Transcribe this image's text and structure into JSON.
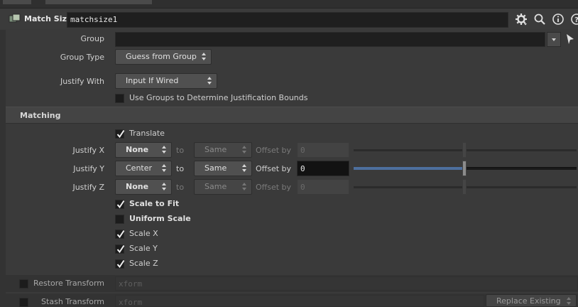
{
  "header": {
    "node_type_label": "Match Size",
    "node_name": "matchsize1",
    "icons": [
      "gear-icon",
      "search-icon",
      "info-icon",
      "help-icon"
    ]
  },
  "params": {
    "group": {
      "label": "Group",
      "value": ""
    },
    "group_type": {
      "label": "Group Type",
      "value": "Guess from Group"
    },
    "justify_with": {
      "label": "Justify With",
      "value": "Input If Wired"
    },
    "use_groups": {
      "label": "Use Groups to Determine Justification Bounds",
      "checked": false
    }
  },
  "matching": {
    "section_label": "Matching",
    "translate": {
      "label": "Translate",
      "checked": true
    },
    "to_label": "to",
    "offset_label": "Offset by",
    "rows": [
      {
        "label": "Justify X",
        "justify": "None",
        "to": "Same",
        "offset": "0",
        "enabled": false
      },
      {
        "label": "Justify Y",
        "justify": "Center",
        "to": "Same",
        "offset": "0",
        "enabled": true
      },
      {
        "label": "Justify Z",
        "justify": "None",
        "to": "Same",
        "offset": "0",
        "enabled": false
      }
    ],
    "scale_to_fit": {
      "label": "Scale to Fit",
      "checked": true
    },
    "uniform_scale": {
      "label": "Uniform Scale",
      "checked": false
    },
    "scale_x": {
      "label": "Scale X",
      "checked": true
    },
    "scale_y": {
      "label": "Scale Y",
      "checked": true
    },
    "scale_z": {
      "label": "Scale Z",
      "checked": true
    }
  },
  "transform": {
    "restore": {
      "label": "Restore Transform",
      "value": "xform",
      "checked": false
    },
    "stash": {
      "label": "Stash Transform",
      "value": "xform",
      "checked": false,
      "mode": "Replace Existing"
    }
  },
  "colors": {
    "accent": "#4d6f9e",
    "background": "#3a3a3a",
    "field": "#1f1f1f"
  }
}
